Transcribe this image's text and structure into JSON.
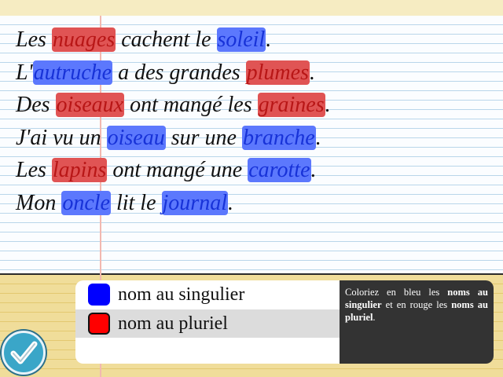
{
  "sentences": [
    {
      "parts": [
        {
          "t": "Les "
        },
        {
          "t": "nuages",
          "c": "red"
        },
        {
          "t": " cachent le "
        },
        {
          "t": "soleil",
          "c": "blue"
        },
        {
          "t": "."
        }
      ]
    },
    {
      "parts": [
        {
          "t": "L'"
        },
        {
          "t": "autruche",
          "c": "blue"
        },
        {
          "t": " a des grandes "
        },
        {
          "t": "plumes",
          "c": "red"
        },
        {
          "t": "."
        }
      ]
    },
    {
      "parts": [
        {
          "t": "Des "
        },
        {
          "t": "oiseaux",
          "c": "red"
        },
        {
          "t": " ont mangé les "
        },
        {
          "t": "graines",
          "c": "red"
        },
        {
          "t": "."
        }
      ]
    },
    {
      "parts": [
        {
          "t": "J'ai vu un "
        },
        {
          "t": "oiseau",
          "c": "blue"
        },
        {
          "t": " sur une "
        },
        {
          "t": "branche",
          "c": "blue"
        },
        {
          "t": "."
        }
      ]
    },
    {
      "parts": [
        {
          "t": "Les "
        },
        {
          "t": "lapins",
          "c": "red"
        },
        {
          "t": " ont mangé une "
        },
        {
          "t": "carotte",
          "c": "blue"
        },
        {
          "t": "."
        }
      ]
    },
    {
      "parts": [
        {
          "t": "Mon "
        },
        {
          "t": "oncle",
          "c": "blue"
        },
        {
          "t": " lit le "
        },
        {
          "t": "journal",
          "c": "blue"
        },
        {
          "t": "."
        }
      ]
    }
  ],
  "legend": {
    "singular_label": "nom au singulier",
    "plural_label": "nom au pluriel",
    "singular_color": "#0000ff",
    "plural_color": "#ff0000",
    "selected": "plural"
  },
  "instructions": {
    "p1": "Coloriez en bleu les ",
    "b1": "noms au singulier",
    "p2": " et en rouge les ",
    "b2": "noms au pluriel",
    "p3": "."
  },
  "check_button": {
    "icon": "checkmark-icon"
  }
}
